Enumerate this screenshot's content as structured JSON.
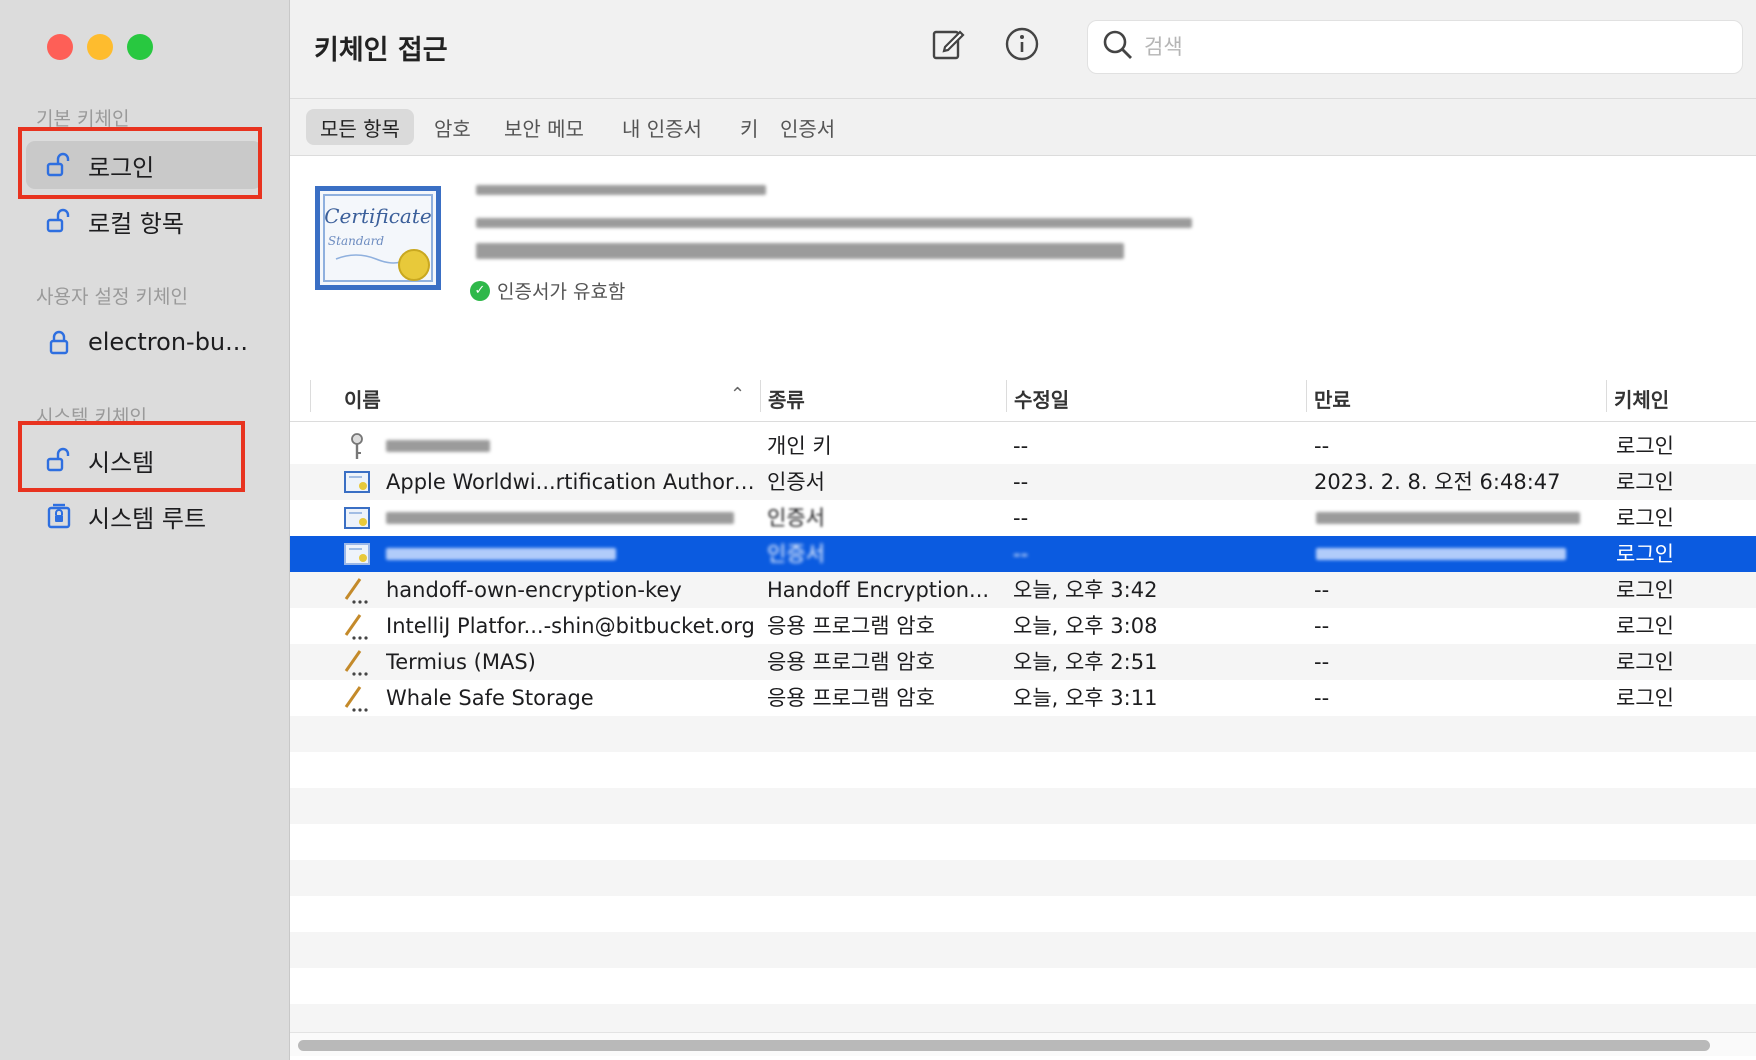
{
  "window": {
    "title": "키체인 접근"
  },
  "sidebar": {
    "sections": [
      {
        "header": "기본 키체인",
        "items": [
          {
            "label": "로그인",
            "icon": "unlock-icon"
          },
          {
            "label": "로컬 항목",
            "icon": "unlock-icon"
          }
        ]
      },
      {
        "header": "사용자 설정 키체인",
        "items": [
          {
            "label": "electron-bu...",
            "icon": "lock-icon"
          }
        ]
      },
      {
        "header": "시스템 키체인",
        "items": [
          {
            "label": "시스템",
            "icon": "unlock-icon"
          },
          {
            "label": "시스템 루트",
            "icon": "locked-box-icon"
          }
        ]
      }
    ]
  },
  "toolbar": {
    "search_placeholder": "검색",
    "compose_icon": "compose-icon",
    "info_icon": "info-icon"
  },
  "tabs": [
    "모든 항목",
    "암호",
    "보안 메모",
    "내 인증서",
    "키",
    "인증서"
  ],
  "detail": {
    "status": "인증서가 유효함"
  },
  "table": {
    "columns": [
      "이름",
      "종류",
      "수정일",
      "만료",
      "키체인"
    ],
    "rows": [
      {
        "icon": "key-icon",
        "name": "",
        "kind": "개인 키",
        "modified": "--",
        "expires": "--",
        "keychain": "로그인"
      },
      {
        "icon": "certificate-icon",
        "name": "Apple Worldwi...rtification Authority",
        "kind": "인증서",
        "modified": "--",
        "expires": "2023. 2. 8. 오전 6:48:47",
        "keychain": "로그인"
      },
      {
        "icon": "certificate-icon",
        "name": "",
        "kind": "인증서",
        "modified": "--",
        "expires": "",
        "keychain": "로그인"
      },
      {
        "icon": "certificate-icon",
        "name": "",
        "kind": "인증서",
        "modified": "--",
        "expires": "",
        "keychain": "로그인"
      },
      {
        "icon": "password-icon",
        "name": "handoff-own-encryption-key",
        "kind": "Handoff Encryption...",
        "modified": "오늘, 오후 3:42",
        "expires": "--",
        "keychain": "로그인"
      },
      {
        "icon": "password-icon",
        "name": "IntelliJ Platfor...-shin@bitbucket.org",
        "kind": "응용 프로그램 암호",
        "modified": "오늘, 오후 3:08",
        "expires": "--",
        "keychain": "로그인"
      },
      {
        "icon": "password-icon",
        "name": "Termius (MAS)",
        "kind": "응용 프로그램 암호",
        "modified": "오늘, 오후 2:51",
        "expires": "--",
        "keychain": "로그인"
      },
      {
        "icon": "password-icon",
        "name": "Whale Safe Storage",
        "kind": "응용 프로그램 암호",
        "modified": "오늘, 오후 3:11",
        "expires": "--",
        "keychain": "로그인"
      }
    ]
  },
  "colors": {
    "selection": "#0b5be0",
    "highlight_box": "#e8331f",
    "sidebar_bg": "#dcdcdc"
  }
}
